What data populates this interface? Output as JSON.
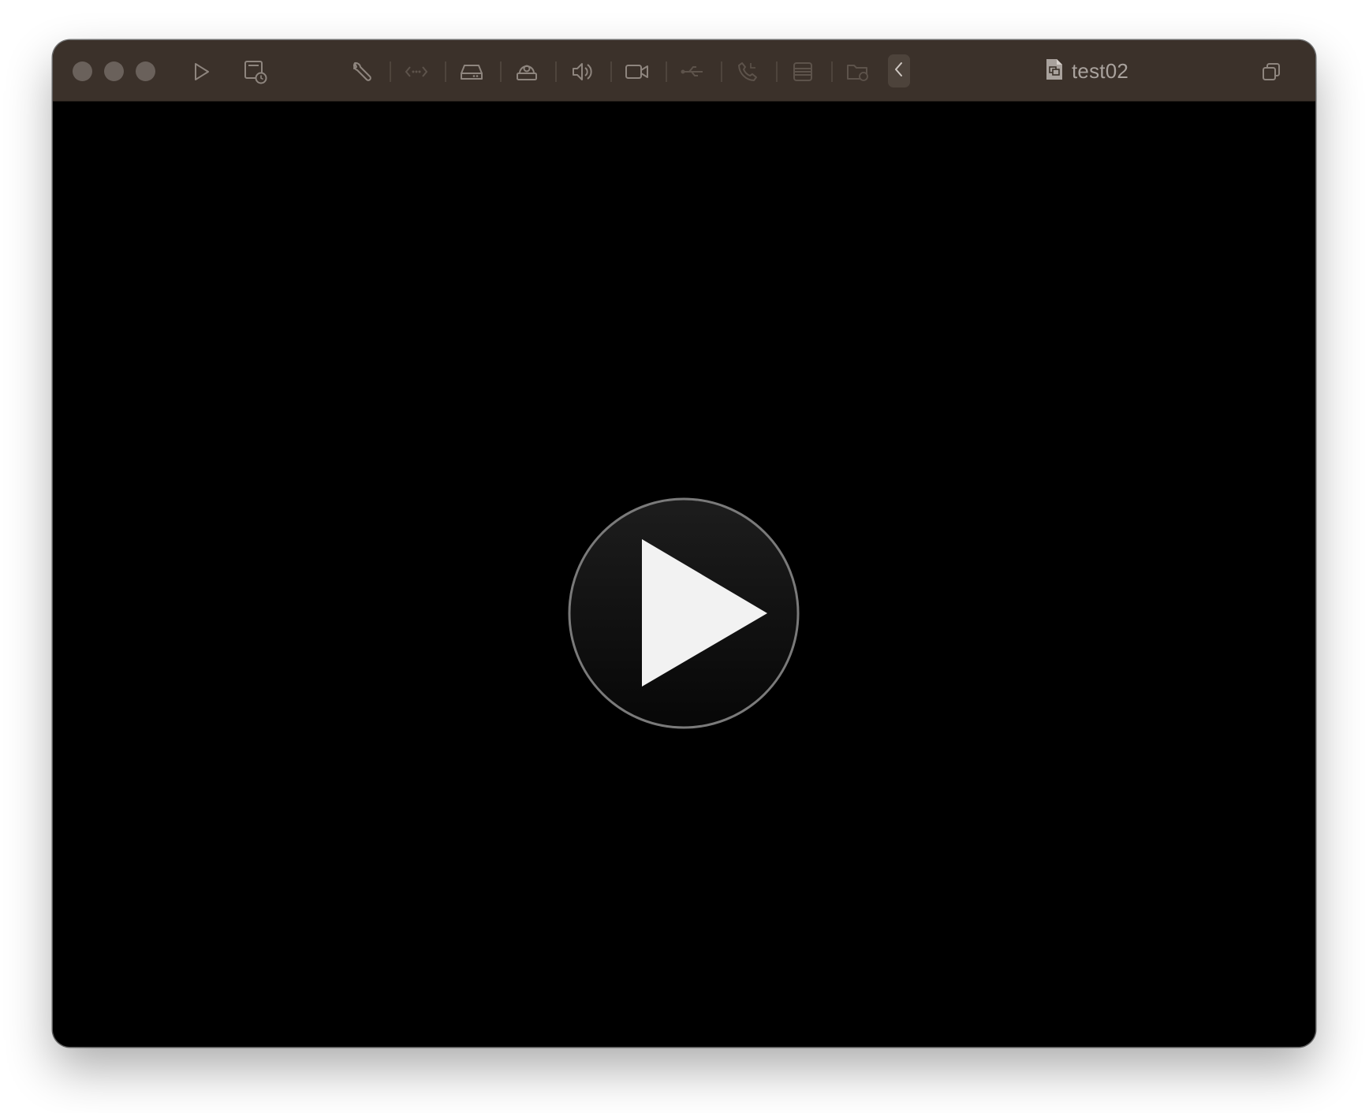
{
  "window": {
    "title": "test02"
  },
  "toolbar": {
    "traffic_lights": [
      "close",
      "minimize",
      "zoom"
    ],
    "left_icons": [
      "play-icon",
      "snapshot-icon"
    ],
    "device_icons": [
      "wrench-icon",
      "network-icon",
      "drive-icon",
      "camera-icon",
      "speaker-icon",
      "video-icon",
      "usb-icon",
      "phone-icon",
      "list-icon",
      "shared-folder-icon"
    ],
    "collapse_icon": "chevron-left-icon",
    "title_icon": "vm-document-icon",
    "right_icon": "window-resize-icon"
  },
  "content": {
    "center_button_icon": "play-icon"
  },
  "colors": {
    "titlebar": "#3b312a",
    "icon": "#8e857e",
    "icon_dim": "#5d534b",
    "content_bg": "#000000",
    "play_fill": "#f2f2f2"
  }
}
